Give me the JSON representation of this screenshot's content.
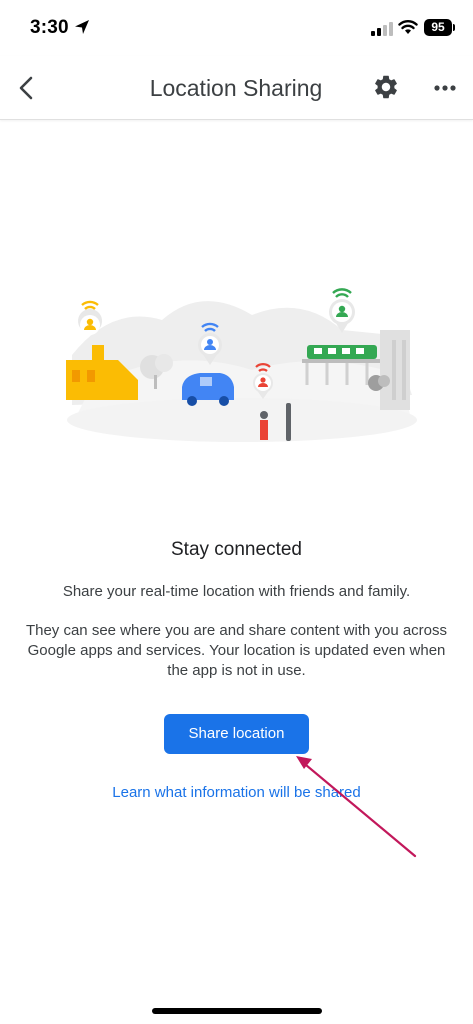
{
  "status_bar": {
    "time": "3:30",
    "battery": "95",
    "icons": [
      "location-arrow-icon",
      "cellular-signal-icon",
      "wifi-icon",
      "battery-icon"
    ]
  },
  "app_bar": {
    "title": "Location Sharing",
    "icons": [
      "back-chevron-icon",
      "gear-icon",
      "more-horizontal-icon"
    ]
  },
  "content": {
    "headline": "Stay connected",
    "paragraph1": "Share your real-time location with friends and family.",
    "paragraph2": "They can see where you are and share content with you across Google apps and services. Your location is updated even when the app is not in use.",
    "share_button": "Share location",
    "learn_link": "Learn what information will be shared"
  },
  "colors": {
    "accent": "#1a73e8",
    "annotation_arrow": "#c2185b",
    "yellow_pin": "#fbbc04",
    "blue_pin": "#4285f4",
    "red_pin": "#ea4335",
    "green_pin": "#34a853"
  }
}
